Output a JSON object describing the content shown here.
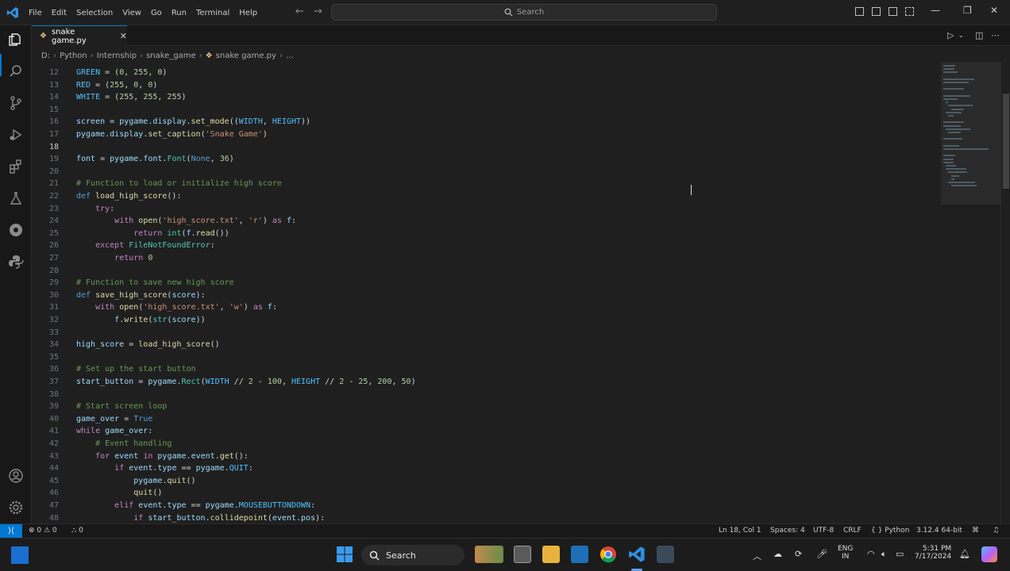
{
  "titlebar": {
    "menus": [
      "File",
      "Edit",
      "Selection",
      "View",
      "Go",
      "Run",
      "Terminal",
      "Help"
    ],
    "search_placeholder": "Search"
  },
  "tab": {
    "filename": "snake game.py",
    "close_glyph": "✕"
  },
  "breadcrumb": [
    "D:",
    "Python",
    "Internship",
    "snake_game",
    "snake game.py",
    "..."
  ],
  "editor": {
    "current_line": 18,
    "lines": [
      {
        "n": 12,
        "html": "<span class='const'>GREEN</span> = (<span class='num'>0</span>, <span class='num'>255</span>, <span class='num'>0</span>)"
      },
      {
        "n": 13,
        "html": "<span class='const'>RED</span> = (<span class='num'>255</span>, <span class='num'>0</span>, <span class='num'>0</span>)"
      },
      {
        "n": 14,
        "html": "<span class='const'>WHITE</span> = (<span class='num'>255</span>, <span class='num'>255</span>, <span class='num'>255</span>)"
      },
      {
        "n": 15,
        "html": ""
      },
      {
        "n": 16,
        "html": "<span class='var'>screen</span> = <span class='var'>pygame</span>.<span class='var'>display</span>.<span class='fn'>set_mode</span>((<span class='const'>WIDTH</span>, <span class='const'>HEIGHT</span>))"
      },
      {
        "n": 17,
        "html": "<span class='var'>pygame</span>.<span class='var'>display</span>.<span class='fn'>set_caption</span>(<span class='str'>'Snake Game'</span>)"
      },
      {
        "n": 18,
        "html": ""
      },
      {
        "n": 19,
        "html": "<span class='var'>font</span> = <span class='var'>pygame</span>.<span class='var'>font</span>.<span class='cls'>Font</span>(<span class='kw2'>None</span>, <span class='num'>36</span>)"
      },
      {
        "n": 20,
        "html": ""
      },
      {
        "n": 21,
        "html": "<span class='cmt'># Function to load or initialize high score</span>"
      },
      {
        "n": 22,
        "html": "<span class='kw2'>def</span> <span class='fn'>load_high_score</span>():"
      },
      {
        "n": 23,
        "html": "    <span class='kw'>try</span>:"
      },
      {
        "n": 24,
        "html": "        <span class='kw'>with</span> <span class='fn'>open</span>(<span class='str'>'high_score.txt'</span>, <span class='str'>'r'</span>) <span class='kw'>as</span> <span class='var'>f</span>:"
      },
      {
        "n": 25,
        "html": "            <span class='kw'>return</span> <span class='cls'>int</span>(<span class='var'>f</span>.<span class='fn'>read</span>())"
      },
      {
        "n": 26,
        "html": "    <span class='kw'>except</span> <span class='cls'>FileNotFoundError</span>:"
      },
      {
        "n": 27,
        "html": "        <span class='kw'>return</span> <span class='num'>0</span>"
      },
      {
        "n": 28,
        "html": ""
      },
      {
        "n": 29,
        "html": "<span class='cmt'># Function to save new high score</span>"
      },
      {
        "n": 30,
        "html": "<span class='kw2'>def</span> <span class='fn'>save_high_score</span>(<span class='var'>score</span>):"
      },
      {
        "n": 31,
        "html": "    <span class='kw'>with</span> <span class='fn'>open</span>(<span class='str'>'high_score.txt'</span>, <span class='str'>'w'</span>) <span class='kw'>as</span> <span class='var'>f</span>:"
      },
      {
        "n": 32,
        "html": "        <span class='var'>f</span>.<span class='fn'>write</span>(<span class='cls'>str</span>(<span class='var'>score</span>))"
      },
      {
        "n": 33,
        "html": ""
      },
      {
        "n": 34,
        "html": "<span class='var'>high_score</span> = <span class='fn'>load_high_score</span>()"
      },
      {
        "n": 35,
        "html": ""
      },
      {
        "n": 36,
        "html": "<span class='cmt'># Set up the start button</span>"
      },
      {
        "n": 37,
        "html": "<span class='var'>start_button</span> = <span class='var'>pygame</span>.<span class='cls'>Rect</span>(<span class='const'>WIDTH</span> // <span class='num'>2</span> - <span class='num'>100</span>, <span class='const'>HEIGHT</span> // <span class='num'>2</span> - <span class='num'>25</span>, <span class='num'>200</span>, <span class='num'>50</span>)"
      },
      {
        "n": 38,
        "html": ""
      },
      {
        "n": 39,
        "html": "<span class='cmt'># Start screen loop</span>"
      },
      {
        "n": 40,
        "html": "<span class='var'>game_over</span> = <span class='kw2'>True</span>"
      },
      {
        "n": 41,
        "html": "<span class='kw'>while</span> <span class='var'>game_over</span>:"
      },
      {
        "n": 42,
        "html": "    <span class='cmt'># Event handling</span>"
      },
      {
        "n": 43,
        "html": "    <span class='kw'>for</span> <span class='var'>event</span> <span class='kw'>in</span> <span class='var'>pygame</span>.<span class='var'>event</span>.<span class='fn'>get</span>():"
      },
      {
        "n": 44,
        "html": "        <span class='kw'>if</span> <span class='var'>event</span>.<span class='var'>type</span> == <span class='var'>pygame</span>.<span class='const'>QUIT</span>:"
      },
      {
        "n": 45,
        "html": "            <span class='var'>pygame</span>.<span class='fn'>quit</span>()"
      },
      {
        "n": 46,
        "html": "            <span class='fn'>quit</span>()"
      },
      {
        "n": 47,
        "html": "        <span class='kw'>elif</span> <span class='var'>event</span>.<span class='var'>type</span> == <span class='var'>pygame</span>.<span class='const'>MOUSEBUTTONDOWN</span>:"
      },
      {
        "n": 48,
        "html": "            <span class='kw'>if</span> <span class='var'>start_button</span>.<span class='fn'>collidepoint</span>(<span class='var'>event</span>.<span class='var'>pos</span>):"
      }
    ]
  },
  "statusbar": {
    "problems": "⊗ 0 ⚠ 0",
    "ports": "⛬ 0",
    "cursor_pos": "Ln 18, Col 1",
    "spaces": "Spaces: 4",
    "encoding": "UTF-8",
    "eol": "CRLF",
    "language": "{ } Python",
    "interpreter": "3.12.4 64-bit"
  },
  "taskbar": {
    "search_label": "Search",
    "lang_line1": "ENG",
    "lang_line2": "IN",
    "time": "5:31 PM",
    "date": "7/17/2024"
  },
  "colors": {
    "accent": "#0078d4",
    "bg": "#1f1f1f"
  }
}
